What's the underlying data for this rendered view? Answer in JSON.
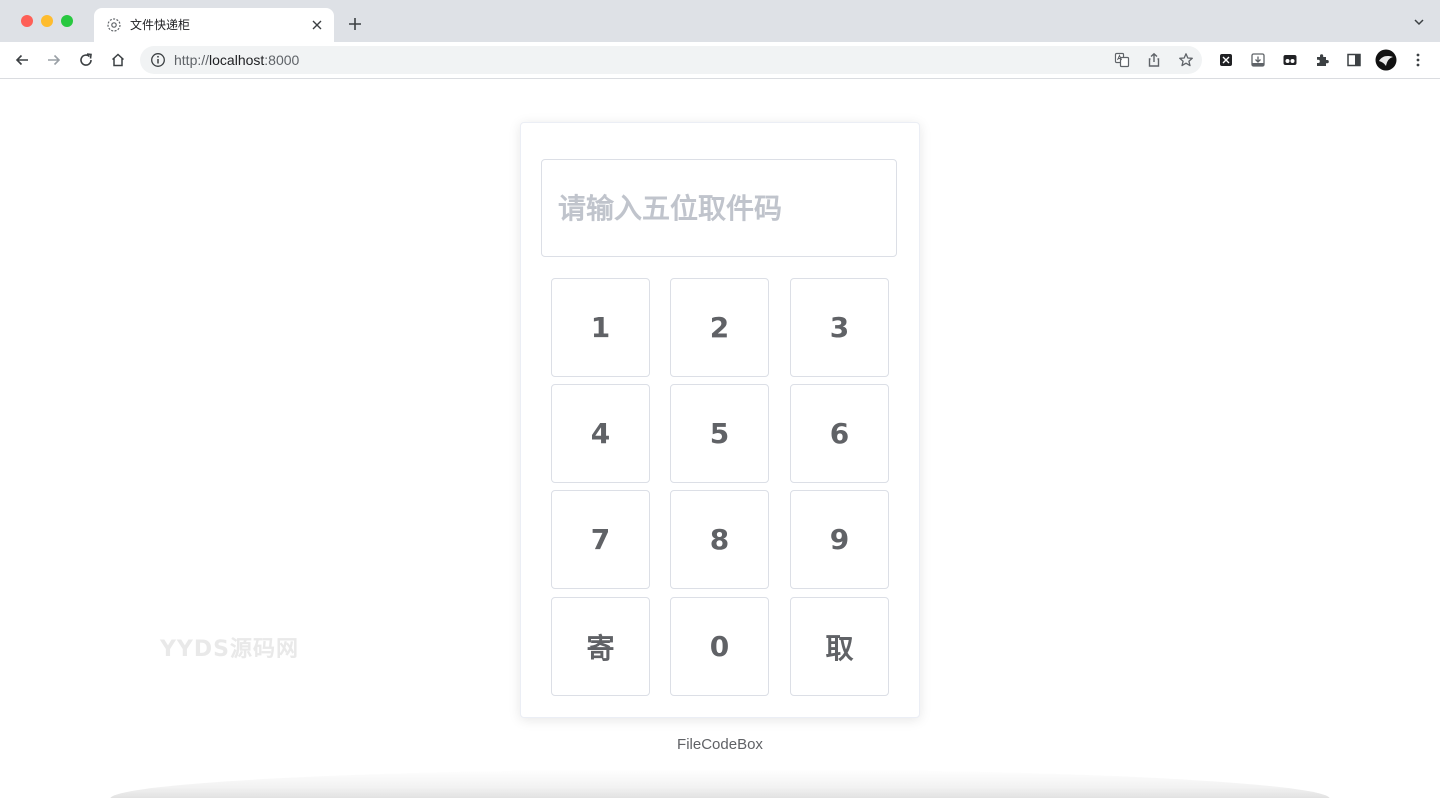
{
  "browser": {
    "tab": {
      "title": "文件快递柜",
      "favicon": "gear-icon"
    },
    "url": {
      "scheme": "http://",
      "host": "localhost",
      "port": ":8000"
    },
    "icons": {
      "back": "back-arrow-icon",
      "forward": "forward-arrow-icon",
      "reload": "reload-icon",
      "home": "home-icon",
      "info": "info-icon",
      "translate": "translate-icon",
      "share": "share-icon",
      "bookmark": "star-icon",
      "extensions": "puzzle-icon",
      "sidepanel": "sidepanel-icon",
      "menu": "kebab-menu-icon"
    }
  },
  "page": {
    "input_placeholder": "请输入五位取件码",
    "keys": [
      "1",
      "2",
      "3",
      "4",
      "5",
      "6",
      "7",
      "8",
      "9",
      "寄",
      "0",
      "取"
    ],
    "footer": "FileCodeBox",
    "watermark": "YYDS源码网"
  },
  "colors": {
    "key_text": "#606266",
    "placeholder": "#c0c4cc",
    "border": "#dcdfe6"
  }
}
